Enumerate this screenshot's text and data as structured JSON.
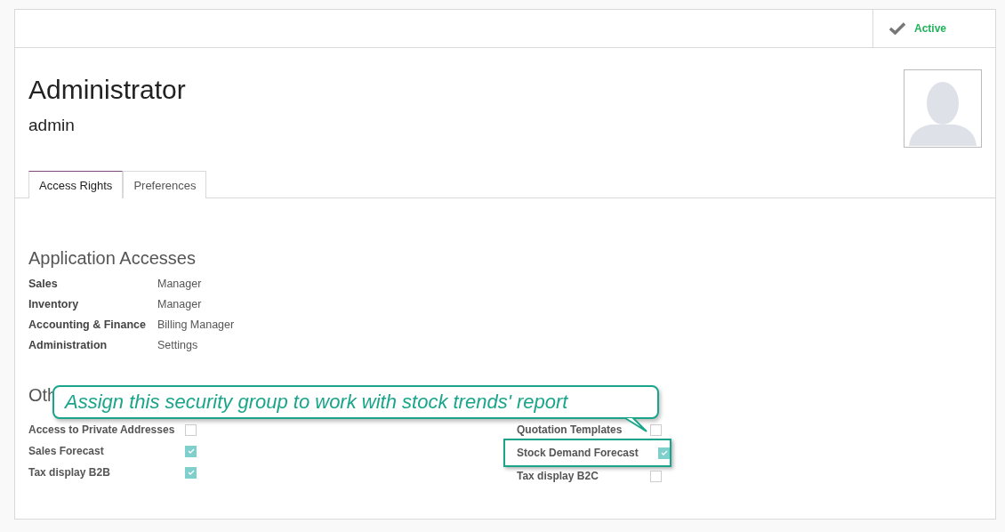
{
  "status": {
    "label": "Active",
    "active": true
  },
  "user": {
    "name": "Administrator",
    "login": "admin"
  },
  "tabs": [
    {
      "label": "Access Rights",
      "selected": true
    },
    {
      "label": "Preferences",
      "selected": false
    }
  ],
  "application_accesses": {
    "title": "Application Accesses",
    "rows": [
      {
        "label": "Sales",
        "value": "Manager"
      },
      {
        "label": "Inventory",
        "value": "Manager"
      },
      {
        "label": "Accounting & Finance",
        "value": "Billing Manager"
      },
      {
        "label": "Administration",
        "value": "Settings"
      }
    ]
  },
  "other": {
    "title": "Oth",
    "columns": [
      [
        {
          "label": "Access to Private Addresses",
          "checked": false,
          "highlighted": false
        },
        {
          "label": "Sales Forecast",
          "checked": true,
          "highlighted": false
        },
        {
          "label": "Tax display B2B",
          "checked": true,
          "highlighted": false
        }
      ],
      [
        {
          "label": "Quotation Templates",
          "checked": false,
          "highlighted": false
        },
        {
          "label": "Stock Demand Forecast",
          "checked": true,
          "highlighted": true
        },
        {
          "label": "Tax display B2C",
          "checked": false,
          "highlighted": false
        }
      ]
    ]
  },
  "callout": {
    "text": "Assign this security group to work with stock trends' report"
  }
}
